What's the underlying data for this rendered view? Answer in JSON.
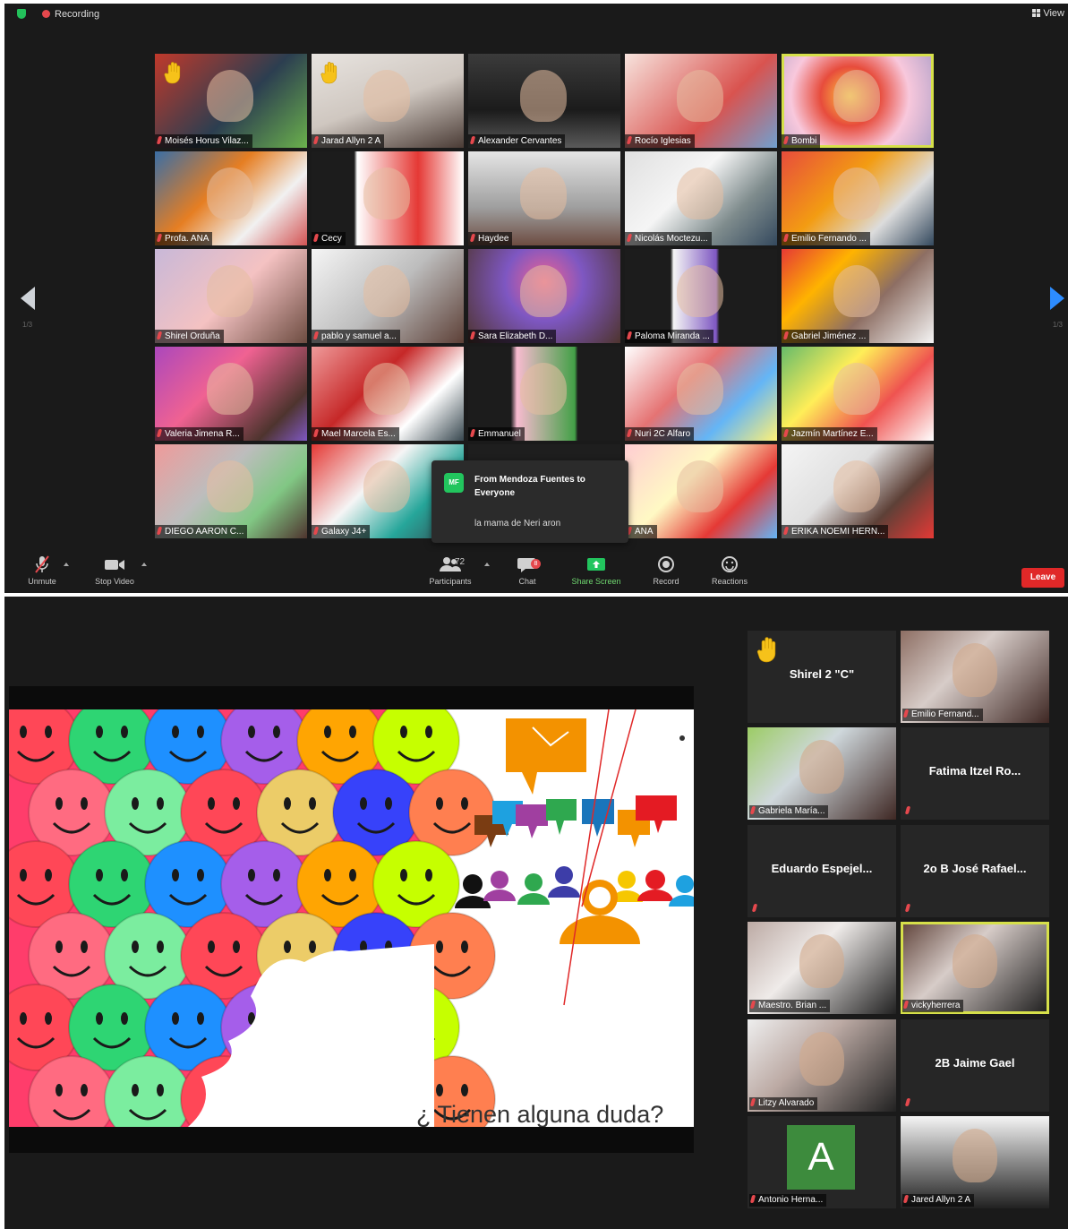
{
  "screen1": {
    "recording_label": "Recording",
    "view_label": "View",
    "page_left": "1/3",
    "page_right": "1/3",
    "tiles": [
      {
        "name": "Moisés Horus Vilaz...",
        "hand": true
      },
      {
        "name": "Jarad Allyn 2 A",
        "hand": true
      },
      {
        "name": "Alexander Cervantes",
        "hand": false
      },
      {
        "name": "Rocío Iglesias",
        "hand": false
      },
      {
        "name": "Bombi",
        "hand": false,
        "active": true
      },
      {
        "name": "Profa. ANA",
        "hand": false
      },
      {
        "name": "Cecy",
        "hand": false
      },
      {
        "name": "Haydee",
        "hand": false
      },
      {
        "name": "Nicolás Moctezu...",
        "hand": false
      },
      {
        "name": "Emilio Fernando ...",
        "hand": false
      },
      {
        "name": "Shirel Orduña",
        "hand": false
      },
      {
        "name": "pablo y samuel a...",
        "hand": false
      },
      {
        "name": "Sara Elizabeth D...",
        "hand": false
      },
      {
        "name": "Paloma Miranda ...",
        "hand": false
      },
      {
        "name": "Gabriel Jiménez ...",
        "hand": false
      },
      {
        "name": "Valeria Jimena R...",
        "hand": false
      },
      {
        "name": "Mael Marcela Es...",
        "hand": false
      },
      {
        "name": "Emmanuel",
        "hand": false
      },
      {
        "name": "Nuri 2C Alfaro",
        "hand": false
      },
      {
        "name": "Jazmín Martínez E...",
        "hand": false
      },
      {
        "name": "DIEGO AARON C...",
        "hand": false
      },
      {
        "name": "Galaxy J4+",
        "hand": false
      },
      {
        "name": "",
        "hand": false,
        "hidden": true
      },
      {
        "name": "ANA",
        "hand": false
      },
      {
        "name": "ERIKA NOEMI HERN...",
        "hand": false
      }
    ],
    "chat": {
      "avatar_initials": "MF",
      "from": "From Mendoza Fuentes to Everyone",
      "message": "la mama de Neri aron"
    },
    "toolbar": {
      "unmute": "Unmute",
      "stop_video": "Stop Video",
      "participants": "Participants",
      "participants_count": "72",
      "chat": "Chat",
      "chat_badge": "8",
      "share_screen": "Share Screen",
      "record": "Record",
      "reactions": "Reactions",
      "leave": "Leave"
    }
  },
  "screen2": {
    "slide_question": "¿ Tienen alguna duda?",
    "side_tiles": [
      {
        "name": "Shirel 2 \"C\"",
        "style": "center",
        "hand": true
      },
      {
        "name": "Emilio Fernand...",
        "style": "label"
      },
      {
        "name": "Gabriela María...",
        "style": "label"
      },
      {
        "name": "Fatima Itzel Ro...",
        "style": "center"
      },
      {
        "name": "Eduardo  Espejel...",
        "style": "center"
      },
      {
        "name": "2o B José Rafael...",
        "style": "center"
      },
      {
        "name": "Maestro. Brian ...",
        "style": "label"
      },
      {
        "name": "vickyherrera",
        "style": "label",
        "active": true
      },
      {
        "name": "Litzy Alvarado",
        "style": "label"
      },
      {
        "name": "2B Jaime Gael",
        "style": "center"
      },
      {
        "name": "Antonio Herna...",
        "style": "label",
        "avatar_letter": "A"
      },
      {
        "name": "Jared Allyn 2 A",
        "style": "label"
      }
    ]
  },
  "colors": {
    "zoom_bg": "#1a1a1a",
    "active_speaker": "#d6e04a",
    "leave_red": "#e02828",
    "share_green": "#22c55e",
    "nav_blue": "#2d8cff"
  }
}
